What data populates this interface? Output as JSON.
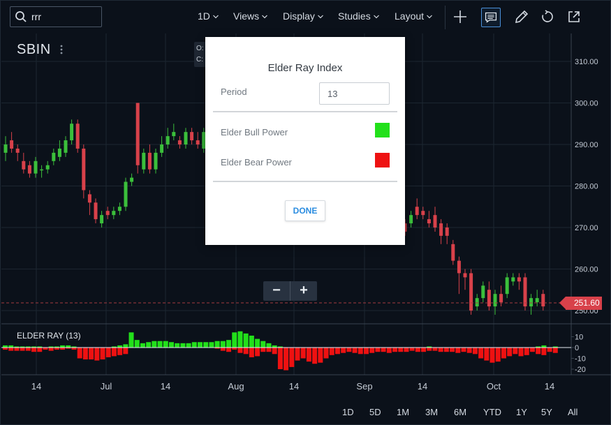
{
  "toolbar": {
    "search_value": "rrr",
    "interval_label": "1D",
    "views_label": "Views",
    "display_label": "Display",
    "studies_label": "Studies",
    "layout_label": "Layout",
    "icons": [
      "crosshair-icon",
      "comment-icon",
      "draw-icon",
      "reset-icon",
      "share-icon"
    ]
  },
  "chart": {
    "symbol": "SBIN",
    "ohlc_labels": [
      "O:",
      "C:"
    ],
    "current_price": "251.60",
    "zoom_out_label": "−",
    "zoom_in_label": "+",
    "study_label": "ELDER RAY (13)"
  },
  "chart_data": {
    "type": "candlestick",
    "y_axis_labels": [
      "310.00",
      "300.00",
      "290.00",
      "280.00",
      "270.00",
      "260.00",
      "250.00"
    ],
    "study_axis_labels": [
      "10",
      "0",
      "-10",
      "-20"
    ],
    "x_axis_labels": [
      "14",
      "Jul",
      "14",
      "Aug",
      "14",
      "Sep",
      "14",
      "Oct",
      "14"
    ],
    "current_price": 251.6,
    "colors": {
      "up": "#3bbf3b",
      "down": "#d8414a",
      "bull": "#22e01a",
      "bear": "#ee1111"
    },
    "candles": [
      {
        "o": 288,
        "c": 290,
        "h": 292,
        "l": 286
      },
      {
        "o": 291,
        "c": 289,
        "h": 293,
        "l": 288
      },
      {
        "o": 289,
        "c": 288,
        "h": 290,
        "l": 286
      },
      {
        "o": 286,
        "c": 284,
        "h": 288,
        "l": 283
      },
      {
        "o": 285,
        "c": 283,
        "h": 286,
        "l": 282
      },
      {
        "o": 283,
        "c": 286,
        "h": 287,
        "l": 282
      },
      {
        "o": 284,
        "c": 284,
        "h": 285,
        "l": 282
      },
      {
        "o": 284,
        "c": 285,
        "h": 286,
        "l": 283
      },
      {
        "o": 286,
        "c": 288,
        "h": 289,
        "l": 285
      },
      {
        "o": 287,
        "c": 289,
        "h": 291,
        "l": 286
      },
      {
        "o": 288,
        "c": 291,
        "h": 292,
        "l": 287
      },
      {
        "o": 291,
        "c": 295,
        "h": 296,
        "l": 290
      },
      {
        "o": 295,
        "c": 289,
        "h": 296,
        "l": 288
      },
      {
        "o": 289,
        "c": 279,
        "h": 290,
        "l": 277
      },
      {
        "o": 278,
        "c": 276,
        "h": 279,
        "l": 273
      },
      {
        "o": 276,
        "c": 272,
        "h": 277,
        "l": 271
      },
      {
        "o": 271,
        "c": 273,
        "h": 274,
        "l": 270
      },
      {
        "o": 274,
        "c": 273,
        "h": 275,
        "l": 272
      },
      {
        "o": 273,
        "c": 274,
        "h": 275,
        "l": 272
      },
      {
        "o": 274,
        "c": 275,
        "h": 276,
        "l": 273
      },
      {
        "o": 275,
        "c": 281,
        "h": 282,
        "l": 274
      },
      {
        "o": 281,
        "c": 282,
        "h": 283,
        "l": 280
      },
      {
        "o": 300,
        "c": 285,
        "h": 300,
        "l": 283
      },
      {
        "o": 284,
        "c": 288,
        "h": 289,
        "l": 283
      },
      {
        "o": 288,
        "c": 284,
        "h": 290,
        "l": 283
      },
      {
        "o": 284,
        "c": 288,
        "h": 289,
        "l": 283
      },
      {
        "o": 288,
        "c": 290,
        "h": 292,
        "l": 287
      },
      {
        "o": 290,
        "c": 292,
        "h": 294,
        "l": 289
      },
      {
        "o": 292,
        "c": 293,
        "h": 295,
        "l": 291
      },
      {
        "o": 291,
        "c": 290,
        "h": 292,
        "l": 289
      },
      {
        "o": 290,
        "c": 293,
        "h": 294,
        "l": 289
      },
      {
        "o": 293,
        "c": 291,
        "h": 294,
        "l": 290
      },
      {
        "o": 291,
        "c": 290,
        "h": 293,
        "l": 289
      },
      {
        "o": 289,
        "c": 293,
        "h": 294,
        "l": 288
      }
    ],
    "candles_right": [
      {
        "o": 271,
        "c": 269,
        "h": 272,
        "l": 268
      },
      {
        "o": 271,
        "c": 273,
        "h": 274,
        "l": 270
      },
      {
        "o": 275,
        "c": 273,
        "h": 277,
        "l": 272
      },
      {
        "o": 274,
        "c": 273,
        "h": 275,
        "l": 272
      },
      {
        "o": 272,
        "c": 271,
        "h": 274,
        "l": 270
      },
      {
        "o": 273,
        "c": 270,
        "h": 275,
        "l": 269
      },
      {
        "o": 271,
        "c": 268,
        "h": 272,
        "l": 266
      },
      {
        "o": 270,
        "c": 268,
        "h": 271,
        "l": 266
      },
      {
        "o": 266,
        "c": 262,
        "h": 267,
        "l": 261
      },
      {
        "o": 262,
        "c": 259,
        "h": 263,
        "l": 254
      },
      {
        "o": 259,
        "c": 258,
        "h": 260,
        "l": 255
      },
      {
        "o": 259,
        "c": 250,
        "h": 260,
        "l": 249
      },
      {
        "o": 251,
        "c": 253,
        "h": 254,
        "l": 250
      },
      {
        "o": 253,
        "c": 256,
        "h": 257,
        "l": 252
      },
      {
        "o": 255,
        "c": 251,
        "h": 257,
        "l": 250
      },
      {
        "o": 251,
        "c": 254,
        "h": 255,
        "l": 249
      },
      {
        "o": 254,
        "c": 252,
        "h": 256,
        "l": 251
      },
      {
        "o": 254,
        "c": 258,
        "h": 259,
        "l": 253
      },
      {
        "o": 257,
        "c": 258,
        "h": 259,
        "l": 256
      },
      {
        "o": 258,
        "c": 257,
        "h": 259,
        "l": 255
      },
      {
        "o": 258,
        "c": 251,
        "h": 259,
        "l": 250
      },
      {
        "o": 251,
        "c": 253,
        "h": 254,
        "l": 249
      },
      {
        "o": 252,
        "c": 253,
        "h": 255,
        "l": 251
      },
      {
        "o": 254,
        "c": 251,
        "h": 255,
        "l": 250
      }
    ],
    "bull": [
      2,
      2,
      1,
      1,
      1,
      1,
      1,
      0,
      1,
      1,
      2,
      2,
      1,
      0,
      0,
      0,
      0,
      0,
      0,
      1,
      2,
      3,
      14,
      7,
      4,
      5,
      6,
      6,
      6,
      5,
      4,
      4,
      4,
      5,
      5,
      5,
      5,
      6,
      6,
      7,
      14,
      15,
      13,
      11,
      8,
      6,
      4,
      2,
      1,
      0,
      0,
      0,
      0,
      0,
      0,
      0,
      0,
      0,
      0,
      0,
      0,
      0,
      0,
      0,
      0,
      0,
      0,
      0,
      0,
      0,
      0,
      0,
      0,
      0,
      1,
      0,
      0,
      0,
      0,
      0,
      0,
      0,
      0,
      0,
      0,
      0,
      0,
      0,
      0,
      0,
      0,
      0,
      0,
      1,
      2,
      0,
      1
    ],
    "bear": [
      -2,
      -3,
      -3,
      -3,
      -3,
      -4,
      -4,
      -2,
      -3,
      -2,
      -2,
      -1,
      -2,
      -10,
      -11,
      -11,
      -12,
      -11,
      -9,
      -8,
      -7,
      -6,
      0,
      0,
      0,
      0,
      0,
      0,
      0,
      0,
      0,
      0,
      0,
      0,
      0,
      0,
      0,
      -1,
      -3,
      -4,
      -2,
      -5,
      -6,
      -9,
      -8,
      -4,
      -4,
      -6,
      -20,
      -21,
      -18,
      -12,
      -10,
      -13,
      -15,
      -14,
      -10,
      -7,
      -6,
      -5,
      -4,
      -5,
      -6,
      -6,
      -5,
      -4,
      -4,
      -5,
      -4,
      -4,
      -4,
      -3,
      -4,
      -4,
      -3,
      -3,
      -4,
      -4,
      -4,
      -5,
      -4,
      -5,
      -6,
      -10,
      -12,
      -14,
      -13,
      -10,
      -8,
      -6,
      -8,
      -7,
      -4,
      -6,
      -7,
      -4,
      -5,
      -3
    ]
  },
  "dialog": {
    "title": "Elder Ray Index",
    "period_label": "Period",
    "period_value": "13",
    "bull_label": "Elder Bull Power",
    "bear_label": "Elder Bear Power",
    "bull_color": "#22e01a",
    "bear_color": "#ee1111",
    "done_label": "DONE"
  },
  "ranges": [
    "1D",
    "5D",
    "1M",
    "3M",
    "6M",
    "YTD",
    "1Y",
    "5Y",
    "All"
  ]
}
